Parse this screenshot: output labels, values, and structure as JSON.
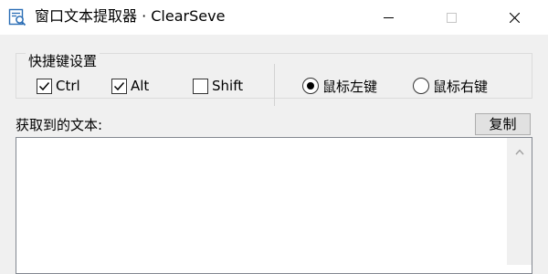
{
  "window": {
    "title": "窗口文本提取器 · ClearSeve"
  },
  "hotkey_group": {
    "label": "快捷键设置",
    "modifiers": [
      {
        "label": "Ctrl",
        "checked": true
      },
      {
        "label": "Alt",
        "checked": true
      },
      {
        "label": "Shift",
        "checked": false
      }
    ],
    "mouse_buttons": [
      {
        "label": "鼠标左键",
        "selected": true
      },
      {
        "label": "鼠标右键",
        "selected": false
      }
    ]
  },
  "text_area": {
    "label": "获取到的文本:",
    "value": ""
  },
  "copy_button": {
    "label": "复制"
  },
  "icons": [
    "window-text-extractor-icon",
    "minimize-icon",
    "maximize-icon",
    "close-icon",
    "checkmark-icon",
    "scroll-up-arrow-icon"
  ],
  "colors": {
    "titlebar": "#ffffff",
    "window_bg": "#f0f0f0",
    "button_bg": "#e1e1e1",
    "textbox_border": "#828790"
  }
}
